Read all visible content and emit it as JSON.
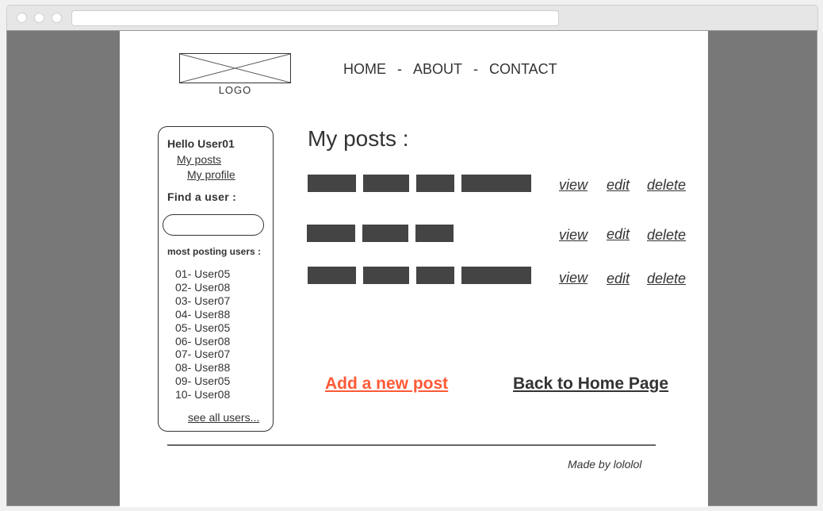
{
  "nav": {
    "home": "HOME",
    "about": "ABOUT",
    "contact": "CONTACT",
    "separator": "-"
  },
  "logo": {
    "label": "LOGO"
  },
  "sidebar": {
    "greeting": "Hello User01",
    "my_posts": "My posts",
    "my_profile": "My profile",
    "find_user_label": "Find a user :",
    "search_placeholder": "",
    "most_posting_title": "most posting users :",
    "users": [
      "01- User05",
      "02- User08",
      "03- User07",
      "04- User88",
      "05- User05",
      "06- User08",
      "07- User07",
      "08- User88",
      "09- User05",
      "10- User08"
    ],
    "see_all": "see all users..."
  },
  "main": {
    "title": "My posts :",
    "actions": {
      "view": "view",
      "edit": "edit",
      "delete": "delete"
    }
  },
  "bottom_links": {
    "add_post": "Add a new post",
    "back_home": "Back to Home Page"
  },
  "colors": {
    "add_post": "#ff5a36",
    "bar": "#444444"
  },
  "footer": {
    "text": "Made by lololol"
  }
}
